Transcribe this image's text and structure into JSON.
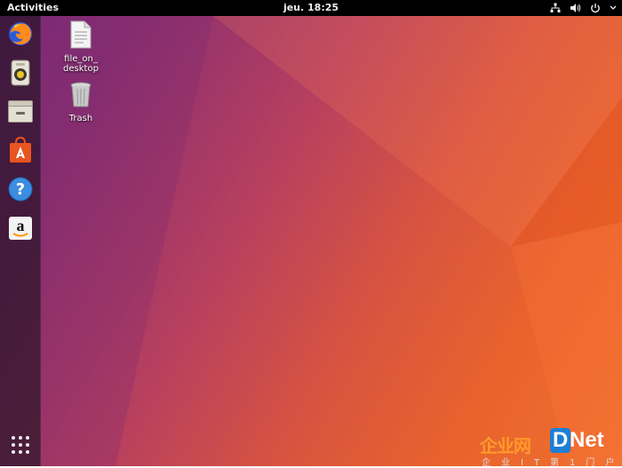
{
  "topbar": {
    "activities_label": "Activities",
    "clock": "jeu. 18:25",
    "tray_icons": [
      "network-icon",
      "volume-icon",
      "power-icon"
    ]
  },
  "dock": {
    "items": [
      {
        "name": "Firefox",
        "icon": "firefox-icon"
      },
      {
        "name": "Rhythmbox",
        "icon": "rhythmbox-icon"
      },
      {
        "name": "Files",
        "icon": "files-icon"
      },
      {
        "name": "Ubuntu Software",
        "icon": "software-icon"
      },
      {
        "name": "Help",
        "icon": "help-icon"
      },
      {
        "name": "Amazon",
        "icon": "amazon-icon"
      }
    ],
    "show_apps_icon": "app-grid-icon"
  },
  "desktop": {
    "icons": [
      {
        "label": "file_on_\ndesktop",
        "icon": "document-icon"
      },
      {
        "label": "Trash",
        "icon": "trash-icon"
      }
    ]
  },
  "watermark": {
    "cn_text": "企业网",
    "d_text": "D",
    "net_text": "Net",
    "sub_text": "企业IT第1门户"
  },
  "colors": {
    "topbar": "#000000",
    "wallpaper_start": "#7a2a78",
    "wallpaper_end": "#f07030"
  }
}
